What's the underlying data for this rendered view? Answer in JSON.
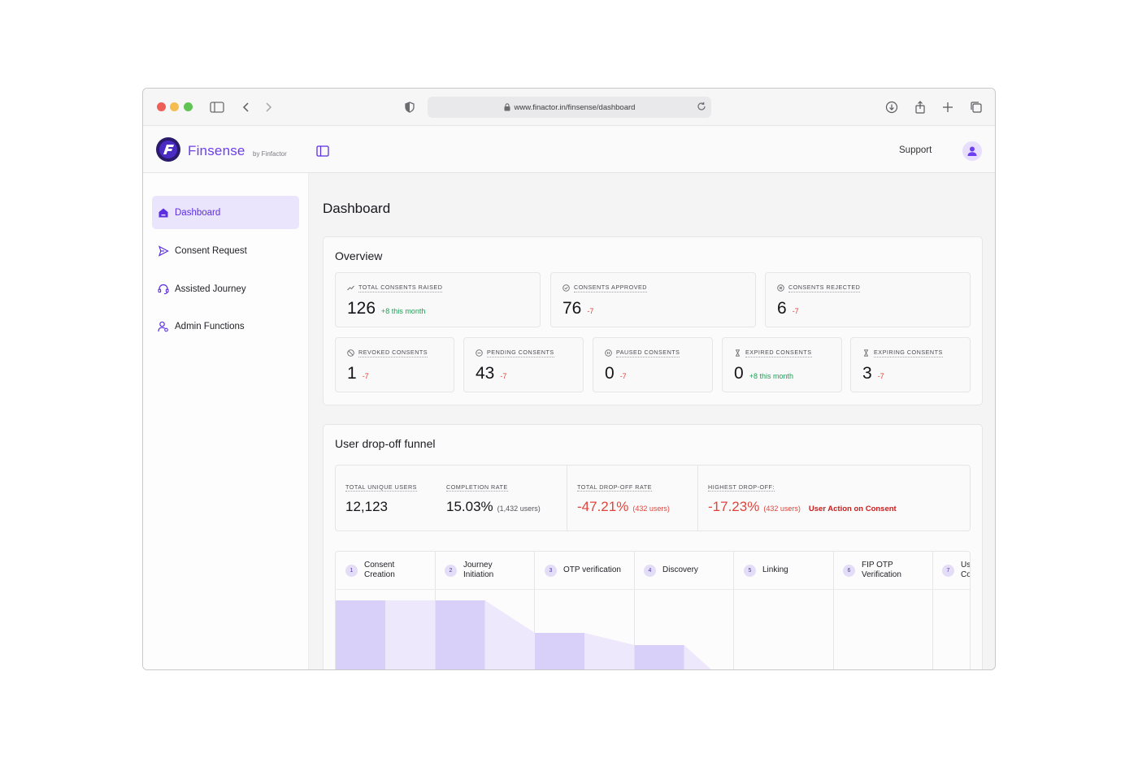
{
  "browser": {
    "url": "www.finactor.in/finsense/dashboard"
  },
  "app": {
    "brand": "Finsense",
    "brand_sub": "by Finfactor",
    "support_label": "Support"
  },
  "sidebar": {
    "items": [
      {
        "label": "Dashboard",
        "icon": "home-icon",
        "active": true
      },
      {
        "label": "Consent Request",
        "icon": "send-icon",
        "active": false
      },
      {
        "label": "Assisted Journey",
        "icon": "headset-icon",
        "active": false
      },
      {
        "label": "Admin Functions",
        "icon": "user-settings-icon",
        "active": false
      }
    ]
  },
  "page": {
    "title": "Dashboard"
  },
  "overview": {
    "title": "Overview",
    "top_stats": [
      {
        "label": "TOTAL CONSENTS RAISED",
        "value": "126",
        "delta": "+8 this month",
        "trend": "pos"
      },
      {
        "label": "CONSENTS APPROVED",
        "value": "76",
        "delta": "-7",
        "trend": "neg"
      },
      {
        "label": "CONSENTS REJECTED",
        "value": "6",
        "delta": "-7",
        "trend": "neg"
      }
    ],
    "bottom_stats": [
      {
        "label": "REVOKED CONSENTS",
        "value": "1",
        "delta": "-7",
        "trend": "neg"
      },
      {
        "label": "PENDING CONSENTS",
        "value": "43",
        "delta": "-7",
        "trend": "neg"
      },
      {
        "label": "PAUSED CONSENTS",
        "value": "0",
        "delta": "-7",
        "trend": "neg"
      },
      {
        "label": "EXPIRED CONSENTS",
        "value": "0",
        "delta": "+8 this month",
        "trend": "pos"
      },
      {
        "label": "EXPIRING CONSENTS",
        "value": "3",
        "delta": "-7",
        "trend": "neg"
      }
    ]
  },
  "funnel": {
    "title": "User drop-off funnel",
    "summary": {
      "total_unique_users": {
        "label": "TOTAL UNIQUE USERS",
        "value": "12,123"
      },
      "completion_rate": {
        "label": "COMPLETION RATE",
        "value": "15.03%",
        "sub": "(1,432 users)"
      },
      "total_drop_off": {
        "label": "TOTAL DROP-OFF RATE",
        "value": "-47.21%",
        "sub": "(432 users)"
      },
      "highest_drop_off": {
        "label": "HIGHEST DROP-OFF:",
        "value": "-17.23%",
        "sub": "(432 users)",
        "stage": "User Action on Consent"
      }
    },
    "stages": [
      {
        "num": "1",
        "label": "Consent\nCreation"
      },
      {
        "num": "2",
        "label": "Journey\nInitiation"
      },
      {
        "num": "3",
        "label": "OTP verification"
      },
      {
        "num": "4",
        "label": "Discovery"
      },
      {
        "num": "5",
        "label": "Linking"
      },
      {
        "num": "6",
        "label": "FIP OTP\nVerification"
      },
      {
        "num": "7",
        "label": "Us\nCo"
      }
    ],
    "bar_levels": [
      1.0,
      1.0,
      0.6,
      0.45,
      0.0,
      0.0,
      0.0
    ],
    "colors": {
      "bar": "#d9d0fa",
      "flow": "#ede8fc"
    }
  }
}
